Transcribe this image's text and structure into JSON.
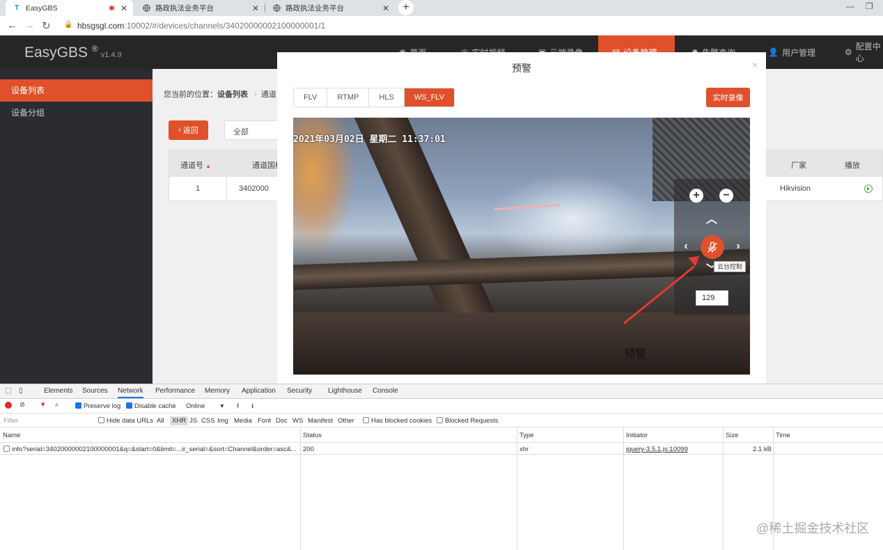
{
  "browser": {
    "tabs": [
      {
        "title": "EasyGBS",
        "icon": "easygbs-logo-icon"
      },
      {
        "title": "路政执法业务平台",
        "icon": "globe-icon"
      },
      {
        "title": "路政执法业务平台",
        "icon": "globe-icon"
      }
    ],
    "url_host": "hbsgsgl.com",
    "url_path": ":10002/#/devices/channels/34020000002100000001/1"
  },
  "app": {
    "logo": "EasyGBS",
    "logo_mark": "®",
    "version": "v1.4.9",
    "nav": [
      "首页",
      "实时视频",
      "云端录像",
      "设备管理",
      "告警查询",
      "用户管理",
      "配置中心"
    ],
    "sidebar": [
      "设备列表",
      "设备分组"
    ],
    "breadcrumb_prefix": "您当前的位置：",
    "breadcrumb_current": "设备列表",
    "breadcrumb_next": "通道",
    "back_label": "返回",
    "filter_value": "全部",
    "table": {
      "headers": [
        "通道号",
        "通道国标",
        "厂家",
        "播放"
      ],
      "row": {
        "channel": "1",
        "gb_id": "3402000",
        "vendor": "Hikvision"
      }
    }
  },
  "modal": {
    "title": "预警",
    "close": "×",
    "stream_tabs": [
      "FLV",
      "RTMP",
      "HLS",
      "WS_FLV"
    ],
    "selected_tab": "WS_FLV",
    "record_button": "实时录像",
    "osd_text": "2021年03月02日  星期二 11:37:01",
    "ptz_tooltip": "云台控制",
    "ptz_speed": "129",
    "annotation_label": "预警"
  },
  "devtools": {
    "tabs": [
      "Elements",
      "Sources",
      "Network",
      "Performance",
      "Memory",
      "Application",
      "Security",
      "Lighthouse",
      "Console"
    ],
    "active_tab": "Network",
    "toolbar": {
      "preserve_log": "Preserve log",
      "disable_cache": "Disable cache",
      "throttle": "Online"
    },
    "filter_placeholder": "Filter",
    "filter_items": [
      "Hide data URLs",
      "All",
      "XHR",
      "JS",
      "CSS",
      "Img",
      "Media",
      "Font",
      "Doc",
      "WS",
      "Manifest",
      "Other"
    ],
    "blocked_cookies": "Has blocked cookies",
    "blocked_requests": "Blocked Requests",
    "columns": [
      "Name",
      "Status",
      "Type",
      "Initiator",
      "Size",
      "Time"
    ],
    "requests": [
      {
        "name": "info?serial=34020000002100000001&q=&start=0&limit=...ir_serial=&sort=Channel&order=asc&...",
        "status": "200",
        "type": "xhr",
        "initiator": "jquery-3.5.1.js:10099",
        "size": "2.1 kB"
      }
    ]
  },
  "watermark": "@稀土掘金技术社区",
  "colors": {
    "accent": "#e0502b",
    "header": "#262626",
    "sidebar": "#2a2c31"
  }
}
